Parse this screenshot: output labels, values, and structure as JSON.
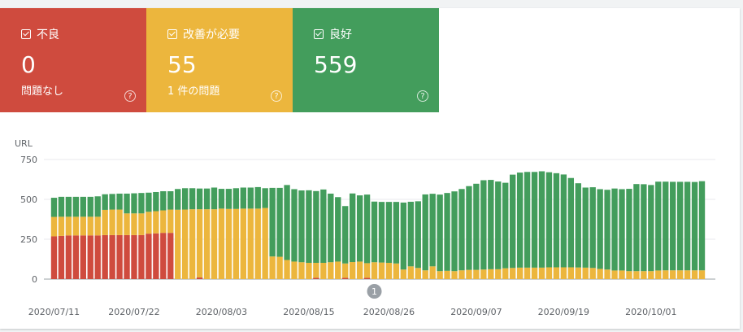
{
  "tiles": [
    {
      "label": "不良",
      "value": "0",
      "sub": "問題なし",
      "color": "#cf4b3e",
      "help": "?"
    },
    {
      "label": "改善が必要",
      "value": "55",
      "sub": "1 件の問題",
      "color": "#ecb63d",
      "help": "?"
    },
    {
      "label": "良好",
      "value": "559",
      "sub": "",
      "color": "#439d5c",
      "help": "?"
    }
  ],
  "chart_data": {
    "type": "bar",
    "stacked": true,
    "ylabel": "URL",
    "ylim": [
      0,
      750
    ],
    "yticks": [
      0,
      250,
      500,
      750
    ],
    "x_tick_labels": [
      {
        "label": "2020/07/11",
        "index": 0
      },
      {
        "label": "2020/07/22",
        "index": 11
      },
      {
        "label": "2020/08/03",
        "index": 23
      },
      {
        "label": "2020/08/15",
        "index": 35
      },
      {
        "label": "2020/08/26",
        "index": 46
      },
      {
        "label": "2020/09/07",
        "index": 58
      },
      {
        "label": "2020/09/19",
        "index": 70
      },
      {
        "label": "2020/10/01",
        "index": 82
      }
    ],
    "annotation": {
      "label": "1",
      "index": 44
    },
    "grid": true,
    "series": [
      {
        "key": "poor",
        "color": "#cf4b3e",
        "values": [
          268,
          271,
          274,
          274,
          274,
          274,
          274,
          276,
          276,
          276,
          276,
          276,
          276,
          285,
          287,
          290,
          290,
          0,
          0,
          0,
          10,
          0,
          0,
          0,
          0,
          0,
          0,
          0,
          0,
          0,
          0,
          0,
          0,
          0,
          0,
          0,
          8,
          0,
          0,
          0,
          8,
          0,
          0,
          8,
          0,
          0,
          0,
          0,
          0,
          0,
          0,
          0,
          0,
          0,
          0,
          0,
          0,
          0,
          0,
          0,
          0,
          0,
          0,
          0,
          0,
          0,
          0,
          0,
          0,
          0,
          0,
          0,
          0,
          0,
          0,
          0,
          0,
          0,
          0,
          0,
          0,
          0,
          0,
          0,
          0,
          0,
          0,
          0,
          0,
          0
        ]
      },
      {
        "key": "needs_improvement",
        "color": "#ecb63d",
        "values": [
          122,
          120,
          117,
          117,
          117,
          117,
          117,
          158,
          160,
          160,
          136,
          136,
          136,
          137,
          139,
          141,
          146,
          435,
          436,
          438,
          428,
          438,
          438,
          442,
          440,
          440,
          442,
          442,
          442,
          446,
          142,
          140,
          120,
          110,
          106,
          102,
          94,
          102,
          106,
          110,
          90,
          107,
          110,
          92,
          106,
          104,
          102,
          98,
          60,
          80,
          70,
          55,
          80,
          50,
          52,
          50,
          55,
          58,
          58,
          60,
          62,
          62,
          68,
          70,
          72,
          72,
          72,
          72,
          74,
          74,
          74,
          74,
          73,
          72,
          70,
          64,
          60,
          54,
          54,
          50,
          50,
          50,
          50,
          54,
          55,
          55,
          55,
          55,
          55,
          55
        ]
      },
      {
        "key": "good",
        "color": "#439d5c",
        "values": [
          120,
          125,
          125,
          125,
          125,
          125,
          128,
          98,
          98,
          100,
          124,
          126,
          128,
          120,
          120,
          120,
          115,
          130,
          134,
          132,
          130,
          130,
          136,
          124,
          126,
          130,
          132,
          132,
          135,
          124,
          430,
          432,
          470,
          454,
          450,
          455,
          450,
          460,
          430,
          404,
          360,
          430,
          415,
          430,
          380,
          380,
          382,
          386,
          420,
          405,
          418,
          476,
          455,
          480,
          488,
          500,
          510,
          525,
          540,
          560,
          560,
          550,
          536,
          585,
          596,
          600,
          600,
          604,
          596,
          590,
          582,
          560,
          528,
          502,
          506,
          500,
          500,
          514,
          510,
          516,
          546,
          545,
          540,
          557,
          556,
          555,
          555,
          555,
          554,
          559
        ]
      }
    ]
  }
}
